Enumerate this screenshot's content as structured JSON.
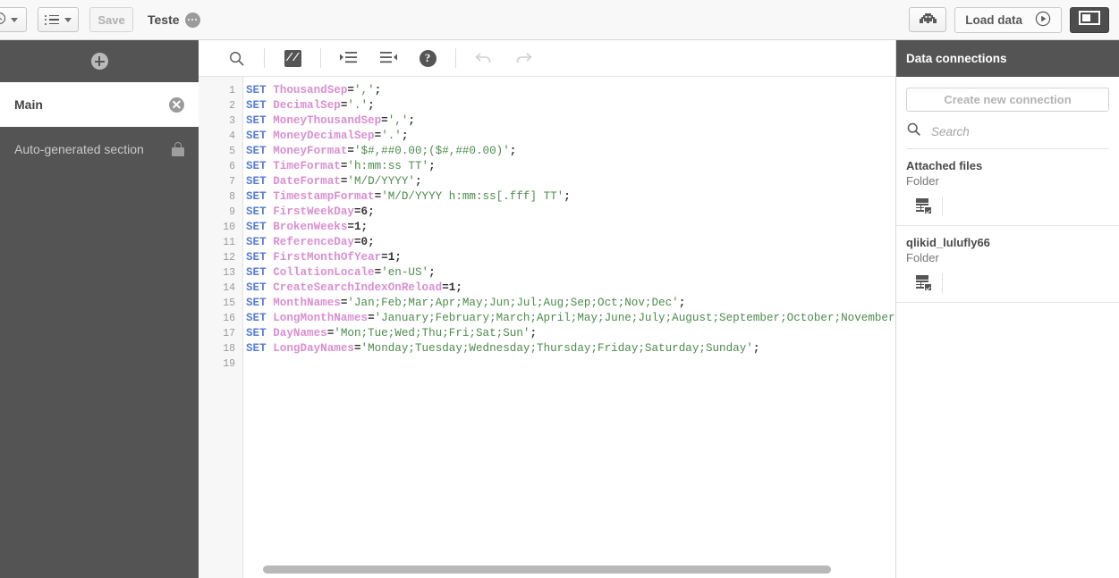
{
  "topbar": {
    "nav_icon": "clock-dropdown-icon",
    "list_icon": "list-dropdown-icon",
    "save_label": "Save",
    "doc_title": "Teste",
    "doc_menu_icon": "more-options-icon",
    "debug_icon": "debug-icon",
    "load_data_label": "Load data",
    "load_data_icon": "play-icon",
    "panel_toggle_icon": "panel-toggle-icon"
  },
  "sidebar": {
    "add_icon": "add-section-icon",
    "items": [
      {
        "label": "Main",
        "icon": "delete-section-icon",
        "state": "active"
      },
      {
        "label": "Auto-generated section",
        "icon": "lock-icon",
        "state": "locked"
      }
    ]
  },
  "editor": {
    "toolbar": [
      {
        "name": "search-icon",
        "glyph": "search",
        "enabled": true
      },
      {
        "name": "comment-icon",
        "glyph": "//",
        "enabled": true
      },
      {
        "name": "indent-increase-icon",
        "glyph": "indent-in",
        "enabled": true
      },
      {
        "name": "indent-decrease-icon",
        "glyph": "indent-out",
        "enabled": true
      },
      {
        "name": "help-icon",
        "glyph": "?",
        "enabled": true
      },
      {
        "name": "undo-icon",
        "glyph": "undo",
        "enabled": false
      },
      {
        "name": "redo-icon",
        "glyph": "redo",
        "enabled": false
      }
    ],
    "line_count": 19,
    "lines": [
      {
        "n": 1,
        "tokens": [
          [
            "k",
            "SET"
          ],
          [
            "sp",
            " "
          ],
          [
            "v",
            "ThousandSep"
          ],
          [
            "op",
            "="
          ],
          [
            "s",
            "','"
          ],
          [
            "op",
            ";"
          ]
        ]
      },
      {
        "n": 2,
        "tokens": [
          [
            "k",
            "SET"
          ],
          [
            "sp",
            " "
          ],
          [
            "v",
            "DecimalSep"
          ],
          [
            "op",
            "="
          ],
          [
            "s",
            "'.'"
          ],
          [
            "op",
            ";"
          ]
        ]
      },
      {
        "n": 3,
        "tokens": [
          [
            "k",
            "SET"
          ],
          [
            "sp",
            " "
          ],
          [
            "v",
            "MoneyThousandSep"
          ],
          [
            "op",
            "="
          ],
          [
            "s",
            "','"
          ],
          [
            "op",
            ";"
          ]
        ]
      },
      {
        "n": 4,
        "tokens": [
          [
            "k",
            "SET"
          ],
          [
            "sp",
            " "
          ],
          [
            "v",
            "MoneyDecimalSep"
          ],
          [
            "op",
            "="
          ],
          [
            "s",
            "'.'"
          ],
          [
            "op",
            ";"
          ]
        ]
      },
      {
        "n": 5,
        "tokens": [
          [
            "k",
            "SET"
          ],
          [
            "sp",
            " "
          ],
          [
            "v",
            "MoneyFormat"
          ],
          [
            "op",
            "="
          ],
          [
            "s",
            "'$#,##0.00;($#,##0.00)'"
          ],
          [
            "op",
            ";"
          ]
        ]
      },
      {
        "n": 6,
        "tokens": [
          [
            "k",
            "SET"
          ],
          [
            "sp",
            " "
          ],
          [
            "v",
            "TimeFormat"
          ],
          [
            "op",
            "="
          ],
          [
            "s",
            "'h:mm:ss TT'"
          ],
          [
            "op",
            ";"
          ]
        ]
      },
      {
        "n": 7,
        "tokens": [
          [
            "k",
            "SET"
          ],
          [
            "sp",
            " "
          ],
          [
            "v",
            "DateFormat"
          ],
          [
            "op",
            "="
          ],
          [
            "s",
            "'M/D/YYYY'"
          ],
          [
            "op",
            ";"
          ]
        ]
      },
      {
        "n": 8,
        "tokens": [
          [
            "k",
            "SET"
          ],
          [
            "sp",
            " "
          ],
          [
            "v",
            "TimestampFormat"
          ],
          [
            "op",
            "="
          ],
          [
            "s",
            "'M/D/YYYY h:mm:ss[.fff] TT'"
          ],
          [
            "op",
            ";"
          ]
        ]
      },
      {
        "n": 9,
        "tokens": [
          [
            "k",
            "SET"
          ],
          [
            "sp",
            " "
          ],
          [
            "v",
            "FirstWeekDay"
          ],
          [
            "op",
            "="
          ],
          [
            "pn",
            "6"
          ],
          [
            "op",
            ";"
          ]
        ]
      },
      {
        "n": 10,
        "tokens": [
          [
            "k",
            "SET"
          ],
          [
            "sp",
            " "
          ],
          [
            "v",
            "BrokenWeeks"
          ],
          [
            "op",
            "="
          ],
          [
            "pn",
            "1"
          ],
          [
            "op",
            ";"
          ]
        ]
      },
      {
        "n": 11,
        "tokens": [
          [
            "k",
            "SET"
          ],
          [
            "sp",
            " "
          ],
          [
            "v",
            "ReferenceDay"
          ],
          [
            "op",
            "="
          ],
          [
            "pn",
            "0"
          ],
          [
            "op",
            ";"
          ]
        ]
      },
      {
        "n": 12,
        "tokens": [
          [
            "k",
            "SET"
          ],
          [
            "sp",
            " "
          ],
          [
            "v",
            "FirstMonthOfYear"
          ],
          [
            "op",
            "="
          ],
          [
            "pn",
            "1"
          ],
          [
            "op",
            ";"
          ]
        ]
      },
      {
        "n": 13,
        "tokens": [
          [
            "k",
            "SET"
          ],
          [
            "sp",
            " "
          ],
          [
            "v",
            "CollationLocale"
          ],
          [
            "op",
            "="
          ],
          [
            "s",
            "'en-US'"
          ],
          [
            "op",
            ";"
          ]
        ]
      },
      {
        "n": 14,
        "tokens": [
          [
            "k",
            "SET"
          ],
          [
            "sp",
            " "
          ],
          [
            "v",
            "CreateSearchIndexOnReload"
          ],
          [
            "op",
            "="
          ],
          [
            "pn",
            "1"
          ],
          [
            "op",
            ";"
          ]
        ]
      },
      {
        "n": 15,
        "tokens": [
          [
            "k",
            "SET"
          ],
          [
            "sp",
            " "
          ],
          [
            "v",
            "MonthNames"
          ],
          [
            "op",
            "="
          ],
          [
            "s",
            "'Jan;Feb;Mar;Apr;May;Jun;Jul;Aug;Sep;Oct;Nov;Dec'"
          ],
          [
            "op",
            ";"
          ]
        ]
      },
      {
        "n": 16,
        "tokens": [
          [
            "k",
            "SET"
          ],
          [
            "sp",
            " "
          ],
          [
            "v",
            "LongMonthNames"
          ],
          [
            "op",
            "="
          ],
          [
            "s",
            "'January;February;March;April;May;June;July;August;September;October;November;December'"
          ],
          [
            "op",
            ";"
          ]
        ]
      },
      {
        "n": 17,
        "tokens": [
          [
            "k",
            "SET"
          ],
          [
            "sp",
            " "
          ],
          [
            "v",
            "DayNames"
          ],
          [
            "op",
            "="
          ],
          [
            "s",
            "'Mon;Tue;Wed;Thu;Fri;Sat;Sun'"
          ],
          [
            "op",
            ";"
          ]
        ]
      },
      {
        "n": 18,
        "tokens": [
          [
            "k",
            "SET"
          ],
          [
            "sp",
            " "
          ],
          [
            "v",
            "LongDayNames"
          ],
          [
            "op",
            "="
          ],
          [
            "s",
            "'Monday;Tuesday;Wednesday;Thursday;Friday;Saturday;Sunday'"
          ],
          [
            "op",
            ";"
          ]
        ]
      },
      {
        "n": 19,
        "tokens": []
      }
    ]
  },
  "right_panel": {
    "title": "Data connections",
    "create_button_label": "Create new connection",
    "search_icon": "search-icon",
    "search_placeholder": "Search",
    "connections": [
      {
        "name": "Attached files",
        "type": "Folder",
        "action_icon": "select-data-icon"
      },
      {
        "name": "qlikid_lulufly66",
        "type": "Folder",
        "action_icon": "select-data-icon"
      }
    ]
  },
  "colors": {
    "chrome_dark": "#545454",
    "keyword": "#5b7fd4",
    "variable": "#d98fd1",
    "string": "#4d8b4d",
    "toolbar_bg": "#f8f8f8"
  }
}
